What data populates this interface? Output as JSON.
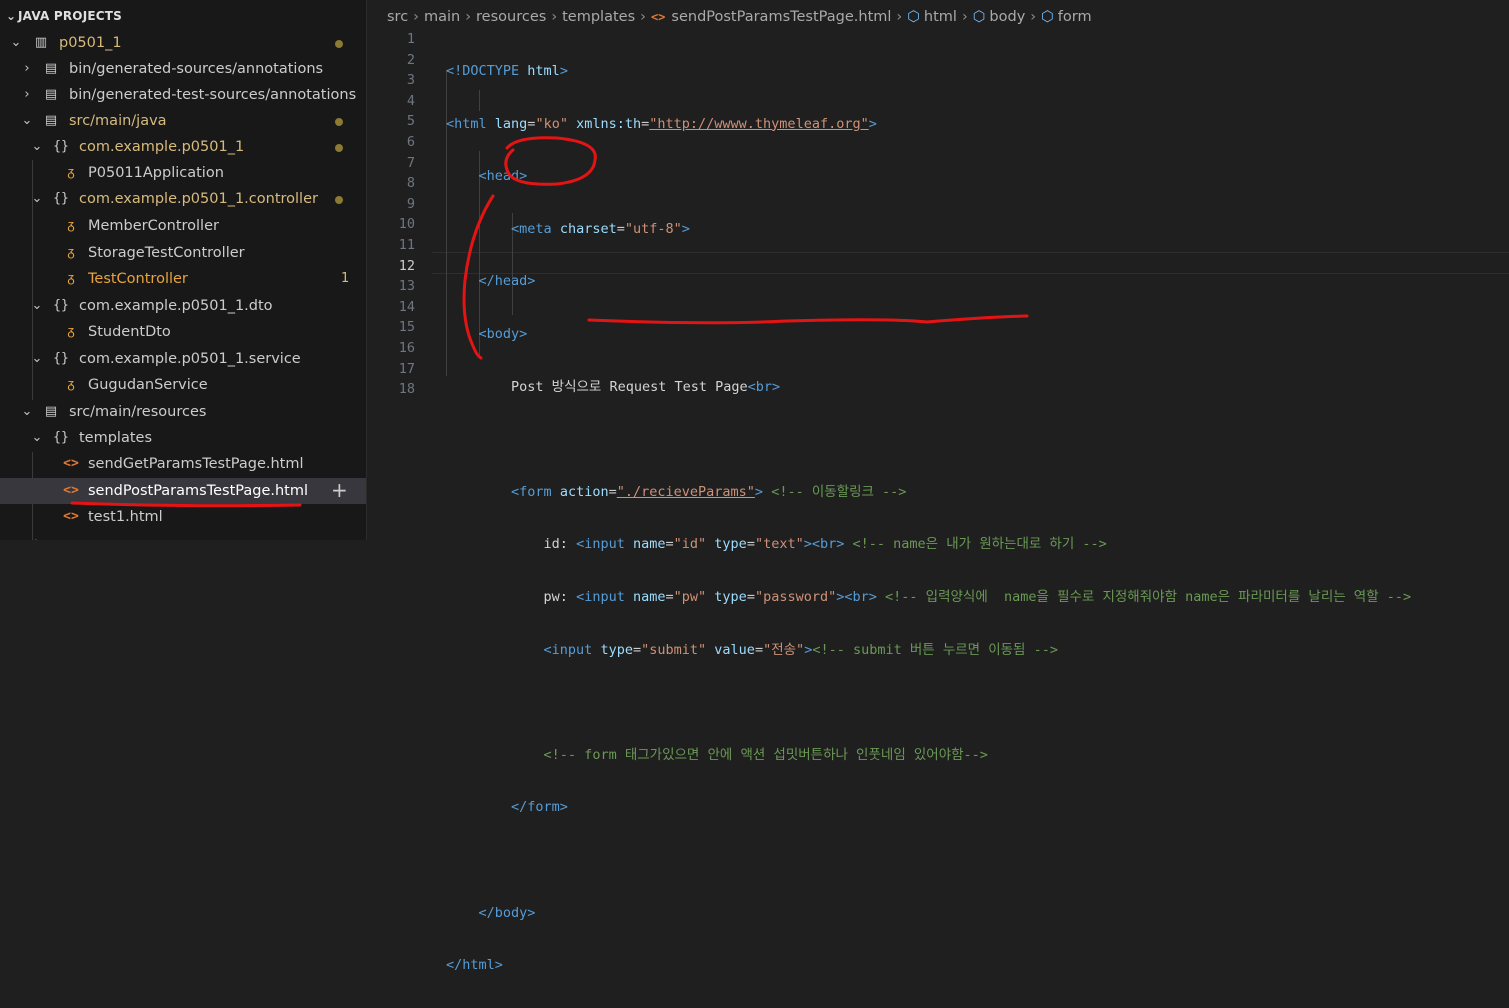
{
  "explorer": {
    "section_title": "JAVA PROJECTS",
    "items": [
      {
        "label": "p0501_1",
        "icon": "project-icon"
      },
      {
        "label": "bin/generated-sources/annotations",
        "icon": "package-folder-icon"
      },
      {
        "label": "bin/generated-test-sources/annotations",
        "icon": "package-folder-icon"
      },
      {
        "label": "src/main/java",
        "icon": "package-folder-icon"
      },
      {
        "label": "com.example.p0501_1",
        "icon": "package-icon"
      },
      {
        "label": "P05011Application",
        "icon": "class-icon"
      },
      {
        "label": "com.example.p0501_1.controller",
        "icon": "package-icon"
      },
      {
        "label": "MemberController",
        "icon": "class-icon"
      },
      {
        "label": "StorageTestController",
        "icon": "class-icon"
      },
      {
        "label": "TestController",
        "icon": "class-icon",
        "badge": "1"
      },
      {
        "label": "com.example.p0501_1.dto",
        "icon": "package-icon"
      },
      {
        "label": "StudentDto",
        "icon": "class-icon"
      },
      {
        "label": "com.example.p0501_1.service",
        "icon": "package-icon"
      },
      {
        "label": "GugudanService",
        "icon": "class-icon"
      },
      {
        "label": "src/main/resources",
        "icon": "package-folder-icon"
      },
      {
        "label": "templates",
        "icon": "package-icon"
      },
      {
        "label": "sendGetParamsTestPage.html",
        "icon": "html-file-icon"
      },
      {
        "label": "sendPostParamsTestPage.html",
        "icon": "html-file-icon"
      },
      {
        "label": "test1.html",
        "icon": "html-file-icon"
      }
    ],
    "colors": {
      "modified": "#cca700",
      "selected_bg": "#37373d"
    }
  },
  "breadcrumb": {
    "parts": [
      "src",
      "main",
      "resources",
      "templates",
      "sendPostParamsTestPage.html",
      "html",
      "body",
      "form"
    ]
  },
  "editor": {
    "line_numbers": [
      "1",
      "2",
      "3",
      "4",
      "5",
      "6",
      "7",
      "8",
      "9",
      "10",
      "11",
      "12",
      "13",
      "14",
      "15",
      "16",
      "17",
      "18"
    ],
    "active_line": "12"
  },
  "code": {
    "l1_doctype": "<!DOCTYPE",
    "l1_html": "html",
    "l1_end": ">",
    "l2_open": "<html",
    "l2_a1": "lang",
    "l2_v1": "\"ko\"",
    "l2_a2": "xmlns:th",
    "l2_v2": "\"http://wwww.thymeleaf.org\"",
    "l3": "<head>",
    "l4_open": "<meta",
    "l4_attr": "charset",
    "l4_val": "\"utf-8\"",
    "l5": "</head>",
    "l6": "<body>",
    "l7_text": "Post 방식으로 Request Test Page",
    "l7_br": "<br>",
    "l9_open": "<form",
    "l9_attr": "action",
    "l9_val": "\"./recieveParams\"",
    "l9_comment": "<!-- 이동할링크 -->",
    "l10_label": "id: ",
    "l10_open": "<input",
    "l10_a1": "name",
    "l10_v1": "\"id\"",
    "l10_a2": "type",
    "l10_v2": "\"text\"",
    "l10_comment": "<!-- name은 내가 원하는대로 하기 -->",
    "l11_label": "pw: ",
    "l11_v1": "\"pw\"",
    "l11_v2": "\"password\"",
    "l11_comment": "<!-- 입력양식에  name을 필수로 지정해줘야함 name은 파라미터를 날리는 역할 -->",
    "l12_open": "<input",
    "l12_a1": "type",
    "l12_v1": "\"submit\"",
    "l12_a2": "value",
    "l12_v2": "\"전송\"",
    "l12_comment": "<!-- submit 버튼 누르면 이동됨 -->",
    "l14_comment": "<!-- form 태그가있으면 안에 액션 섭밋버튼하나 인풋네임 있어야함-->",
    "l15": "</form>",
    "l17": "</body>",
    "l18": "</html>",
    "br": "<br>",
    "eq": "=",
    "gt": ">"
  },
  "colors": {
    "annotation": "#e51414",
    "tag": "#569cd6",
    "attr": "#9cdcfe",
    "string": "#ce9178",
    "comment": "#6a9955"
  }
}
